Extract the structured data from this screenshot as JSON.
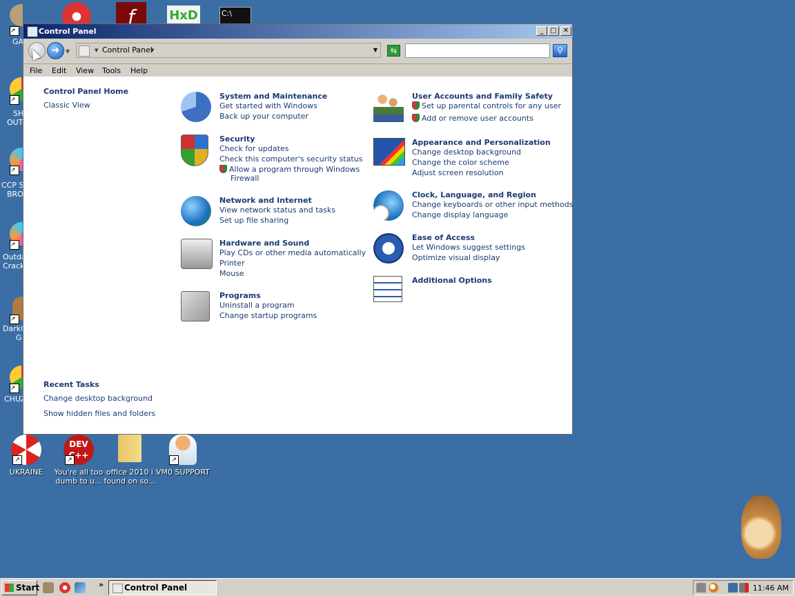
{
  "window": {
    "title": "Control Panel",
    "minimize": "_",
    "maximize": "□",
    "close": "✕"
  },
  "address": {
    "crumb": "Control Panel",
    "search_value": ""
  },
  "menu": [
    "File",
    "Edit",
    "View",
    "Tools",
    "Help"
  ],
  "left": {
    "home": "Control Panel Home",
    "classic": "Classic View",
    "recent_title": "Recent Tasks",
    "recent": [
      "Change desktop background",
      "Show hidden files and folders"
    ]
  },
  "categories_left": [
    {
      "title": "System and Maintenance",
      "links": [
        "Get started with Windows",
        "Back up your computer"
      ]
    },
    {
      "title": "Security",
      "links": [
        "Check for updates",
        "Check this computer's security status",
        "Allow a program through Windows",
        "Firewall"
      ]
    },
    {
      "title": "Network and Internet",
      "links": [
        "View network status and tasks",
        "Set up file sharing"
      ]
    },
    {
      "title": "Hardware and Sound",
      "links": [
        "Play CDs or other media automatically",
        "Printer",
        "Mouse"
      ]
    },
    {
      "title": "Programs",
      "links": [
        "Uninstall a program",
        "Change startup programs"
      ]
    }
  ],
  "categories_right": [
    {
      "title": "User Accounts and Family Safety",
      "links": [
        "Set up parental controls for any user",
        "Add or remove user accounts"
      ]
    },
    {
      "title": "Appearance and Personalization",
      "links": [
        "Change desktop background",
        "Change the color scheme",
        "Adjust screen resolution"
      ]
    },
    {
      "title": "Clock, Language, and Region",
      "links": [
        "Change keyboards or other input methods",
        "Change display language"
      ]
    },
    {
      "title": "Ease of Access",
      "links": [
        "Let Windows suggest settings",
        "Optimize visual display"
      ]
    },
    {
      "title": "Additional Options",
      "links": []
    }
  ],
  "desktop": {
    "clipped_labels": [
      "GA",
      "SH",
      "OUT",
      "CCP SI",
      "BRO",
      "Outda",
      "Crack",
      "DarkC",
      "G",
      "CHUZ"
    ],
    "icons": [
      {
        "label1": "UKRAINE",
        "label2": ""
      },
      {
        "label1": "You're all too",
        "label2": "dumb to u..."
      },
      {
        "label1": "office 2010 i",
        "label2": "found on so..."
      },
      {
        "label1": "VM0 SUPPORT",
        "label2": ""
      }
    ]
  },
  "taskbar": {
    "start": "Start",
    "chevron": "»",
    "task": "Control Panel",
    "clock": "11:46 AM"
  },
  "colors": {
    "desktop": "#3a6ea5",
    "link": "#1a3a73",
    "chrome": "#d4d0c8"
  }
}
